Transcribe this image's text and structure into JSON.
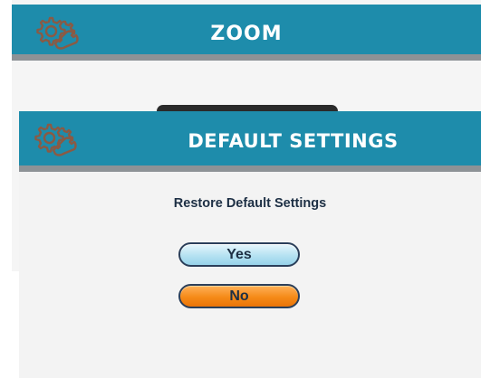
{
  "zoom_panel": {
    "title": "ZOOM",
    "icon": "gear-wrench-icon"
  },
  "dialog": {
    "title": "DEFAULT SETTINGS",
    "icon": "gear-wrench-icon",
    "message": "Restore Default Settings",
    "yes_label": "Yes",
    "no_label": "No"
  },
  "colors": {
    "header_bg": "#1e8cab",
    "header_border": "#8d9296",
    "yes_button": "#b5e2f2",
    "no_button": "#f58a18",
    "text_dark": "#1d2f44",
    "icon_brown": "#8a5a44"
  }
}
